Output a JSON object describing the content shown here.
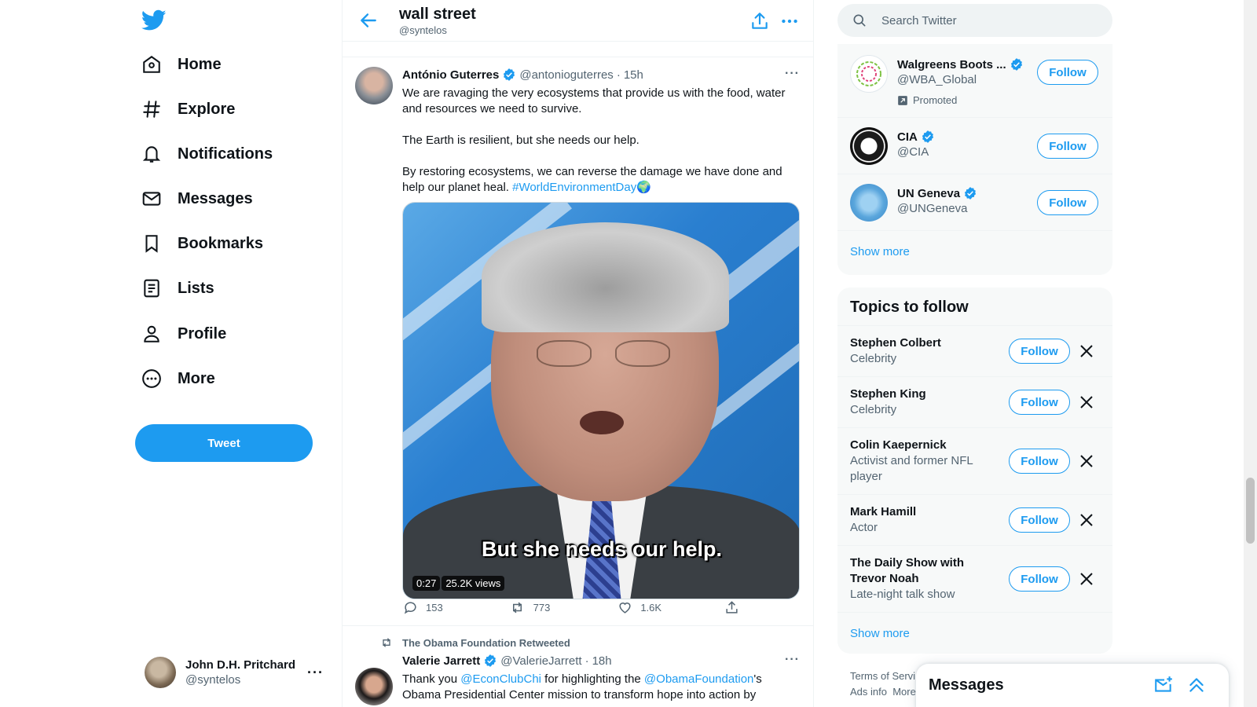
{
  "nav": {
    "items": [
      {
        "label": "Home",
        "icon": "home-icon"
      },
      {
        "label": "Explore",
        "icon": "hashtag-icon"
      },
      {
        "label": "Notifications",
        "icon": "bell-icon"
      },
      {
        "label": "Messages",
        "icon": "envelope-icon"
      },
      {
        "label": "Bookmarks",
        "icon": "bookmark-icon"
      },
      {
        "label": "Lists",
        "icon": "list-icon"
      },
      {
        "label": "Profile",
        "icon": "person-icon"
      },
      {
        "label": "More",
        "icon": "more-circle-icon"
      }
    ],
    "tweet_button": "Tweet",
    "account": {
      "name": "John D.H. Pritchard",
      "handle": "@syntelos",
      "more": "···"
    }
  },
  "header": {
    "title": "wall street",
    "subtitle": "@syntelos"
  },
  "tweets": [
    {
      "name": "António Guterres",
      "handle": "@antonioguterres",
      "sep": "·",
      "time": "15h",
      "verified": true,
      "text": [
        "We are ravaging the very ecosystems that provide us with the food, water and resources we need to survive.",
        "The Earth is resilient, but she needs our help."
      ],
      "text3_prefix": "By restoring ecosystems, we can reverse the damage we have done and help our planet heal. ",
      "hashtag": "#WorldEnvironmentDay",
      "emoji": "🌍",
      "media": {
        "caption": "But she needs our help.",
        "duration": "0:27",
        "views": "25.2K views"
      },
      "replies": "153",
      "retweets": "773",
      "likes": "1.6K"
    },
    {
      "context": "The Obama Foundation Retweeted",
      "name": "Valerie Jarrett",
      "handle": "@ValerieJarrett",
      "sep": "·",
      "time": "18h",
      "verified": true,
      "text_a": "Thank you ",
      "mention1": "@EconClubChi",
      "text_b": " for highlighting the ",
      "mention2": "@ObamaFoundation",
      "text_c": "'s",
      "text_line2": "Obama Presidential Center mission to transform hope into action by"
    }
  ],
  "search": {
    "placeholder": "Search Twitter"
  },
  "who_to_follow": [
    {
      "name": "Walgreens Boots ...",
      "handle": "@WBA_Global",
      "promoted": "Promoted",
      "button": "Follow"
    },
    {
      "name": "CIA",
      "handle": "@CIA",
      "button": "Follow"
    },
    {
      "name": "UN Geneva",
      "handle": "@UNGeneva",
      "button": "Follow"
    }
  ],
  "show_more": "Show more",
  "topics": {
    "title": "Topics to follow",
    "items": [
      {
        "name": "Stephen Colbert",
        "category": "Celebrity",
        "button": "Follow"
      },
      {
        "name": "Stephen King",
        "category": "Celebrity",
        "button": "Follow"
      },
      {
        "name": "Colin Kaepernick",
        "category": "Activist and former NFL player",
        "button": "Follow"
      },
      {
        "name": "Mark Hamill",
        "category": "Actor",
        "button": "Follow"
      },
      {
        "name": "The Daily Show with Trevor Noah",
        "category": "Late-night talk show",
        "button": "Follow"
      }
    ],
    "show_more": "Show more"
  },
  "footer": {
    "terms": "Terms of Servi",
    "ads": "Ads info",
    "more": "More"
  },
  "messages_dock": {
    "title": "Messages"
  },
  "colors": {
    "accent": "#1d9bf0",
    "text": "#0f1419",
    "muted": "#536471"
  }
}
